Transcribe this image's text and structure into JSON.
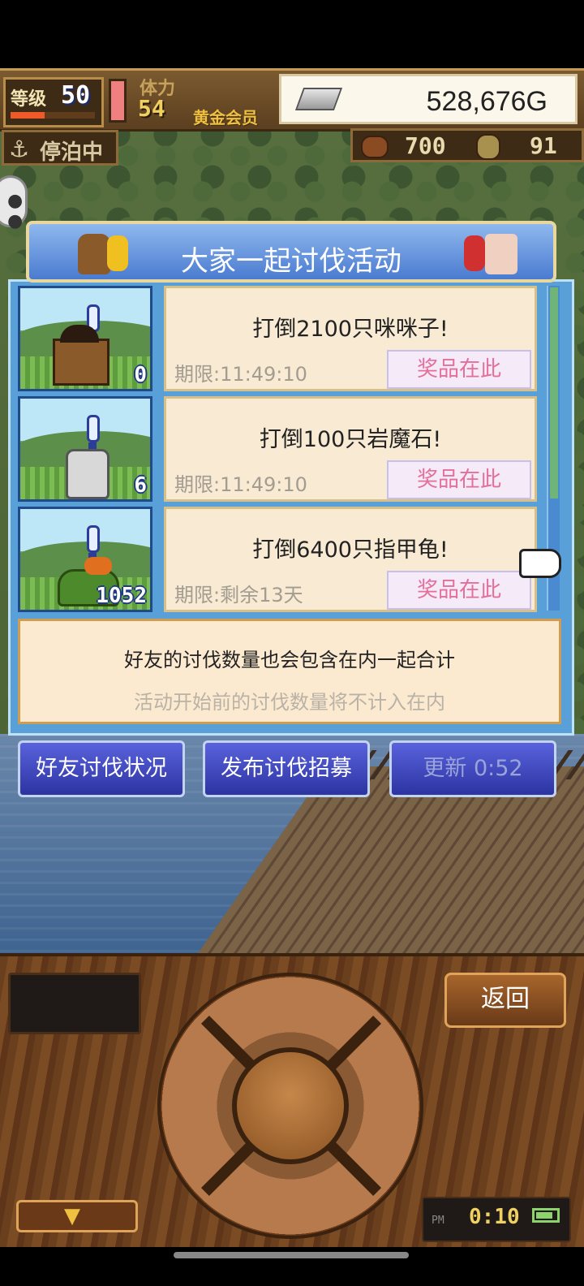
{
  "hud": {
    "level_label": "等级",
    "level_value": "50",
    "level_progress": 0.4,
    "stamina_label": "体力",
    "stamina_value": "54",
    "member_label": "黄金会员",
    "money": "528,676G",
    "anchor_icon": "anchor-icon",
    "anchor_label": "停泊中",
    "wood_value": "700",
    "ore_value": "91"
  },
  "panel": {
    "title": "大家一起讨伐活动",
    "events": [
      {
        "title": "打倒2100只咪咪子!",
        "deadline": "期限:11:49:10",
        "prize": "奖品在此",
        "count": "0",
        "monster": "chest-monster"
      },
      {
        "title": "打倒100只岩魔石!",
        "deadline": "期限:11:49:10",
        "prize": "奖品在此",
        "count": "6",
        "monster": "rock-monster"
      },
      {
        "title": "打倒6400只指甲龟!",
        "deadline": "期限:剩余13天",
        "prize": "奖品在此",
        "count": "1052",
        "monster": "turtle-monster"
      }
    ],
    "info_main": "好友的讨伐数量也会包含在内一起合计",
    "info_sub": "活动开始前的讨伐数量将不计入在内"
  },
  "buttons": {
    "friends": "好友讨伐状况",
    "recruit": "发布讨伐招募",
    "refresh": "更新 0:52"
  },
  "controller": {
    "back": "返回",
    "down_icon": "▼",
    "ampm": "PM",
    "time": "0:10",
    "battery_level": 0.85
  },
  "colors": {
    "panel_blue": "#5aa0d8",
    "prize_text": "#e36f9a",
    "button_blue": "#2c34a2"
  }
}
